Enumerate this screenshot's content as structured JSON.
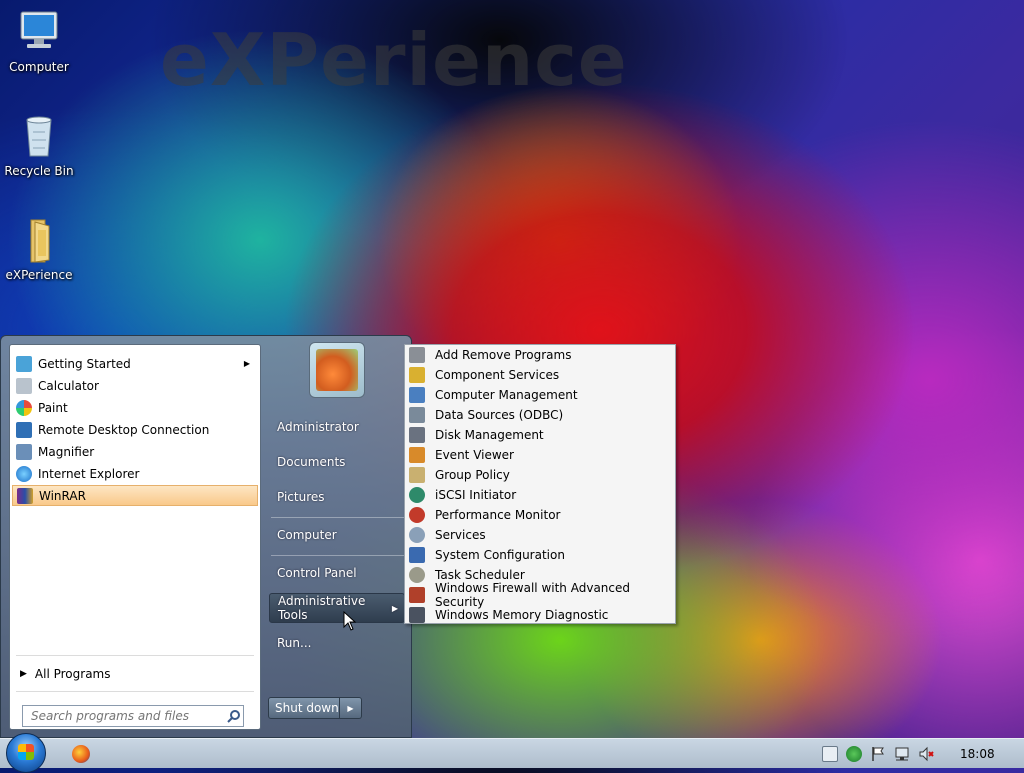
{
  "desktop": {
    "watermark": "eXPerience",
    "icons": [
      {
        "label": "Computer",
        "icon": "computer-icon"
      },
      {
        "label": "Recycle Bin",
        "icon": "recycle-bin-icon"
      },
      {
        "label": "eXPerience",
        "icon": "folder-icon"
      }
    ]
  },
  "start_menu": {
    "programs": [
      {
        "label": "Getting Started",
        "icon": "getting-started-icon",
        "has_submenu": true
      },
      {
        "label": "Calculator",
        "icon": "calculator-icon"
      },
      {
        "label": "Paint",
        "icon": "paint-icon"
      },
      {
        "label": "Remote Desktop Connection",
        "icon": "remote-desktop-icon"
      },
      {
        "label": "Magnifier",
        "icon": "magnifier-icon"
      },
      {
        "label": "Internet Explorer",
        "icon": "internet-explorer-icon"
      },
      {
        "label": "WinRAR",
        "icon": "winrar-icon",
        "selected": true
      }
    ],
    "all_programs": "All Programs",
    "search_placeholder": "Search programs and files",
    "right_links": [
      {
        "label": "Administrator"
      },
      {
        "label": "Documents"
      },
      {
        "label": "Pictures"
      },
      {
        "label": "Computer"
      },
      {
        "label": "Control Panel"
      },
      {
        "label": "Administrative Tools",
        "has_submenu": true,
        "hovered": true
      },
      {
        "label": "Run..."
      }
    ],
    "shutdown_label": "Shut down"
  },
  "admin_tools_menu": {
    "items": [
      {
        "label": "Add Remove Programs",
        "icon": "add-remove-programs-icon",
        "color": "#8a8f96"
      },
      {
        "label": "Component Services",
        "icon": "component-services-icon",
        "color": "#d9b030"
      },
      {
        "label": "Computer Management",
        "icon": "computer-management-icon",
        "color": "#4a7fc0"
      },
      {
        "label": "Data Sources (ODBC)",
        "icon": "data-sources-icon",
        "color": "#7a8a9a"
      },
      {
        "label": "Disk Management",
        "icon": "disk-management-icon",
        "color": "#6a7280"
      },
      {
        "label": "Event Viewer",
        "icon": "event-viewer-icon",
        "color": "#d88a2a"
      },
      {
        "label": "Group Policy",
        "icon": "group-policy-icon",
        "color": "#c9b070"
      },
      {
        "label": "iSCSI Initiator",
        "icon": "iscsi-initiator-icon",
        "color": "#2e8a6a"
      },
      {
        "label": "Performance Monitor",
        "icon": "performance-monitor-icon",
        "color": "#c23a2a"
      },
      {
        "label": "Services",
        "icon": "services-icon",
        "color": "#8aa0b8"
      },
      {
        "label": "System Configuration",
        "icon": "system-configuration-icon",
        "color": "#3a6ab0"
      },
      {
        "label": "Task Scheduler",
        "icon": "task-scheduler-icon",
        "color": "#9a9a8a"
      },
      {
        "label": "Windows Firewall with Advanced Security",
        "icon": "firewall-icon",
        "color": "#b0402a"
      },
      {
        "label": "Windows Memory Diagnostic",
        "icon": "memory-diagnostic-icon",
        "color": "#4a5260"
      }
    ]
  },
  "taskbar": {
    "clock": "18:08"
  }
}
